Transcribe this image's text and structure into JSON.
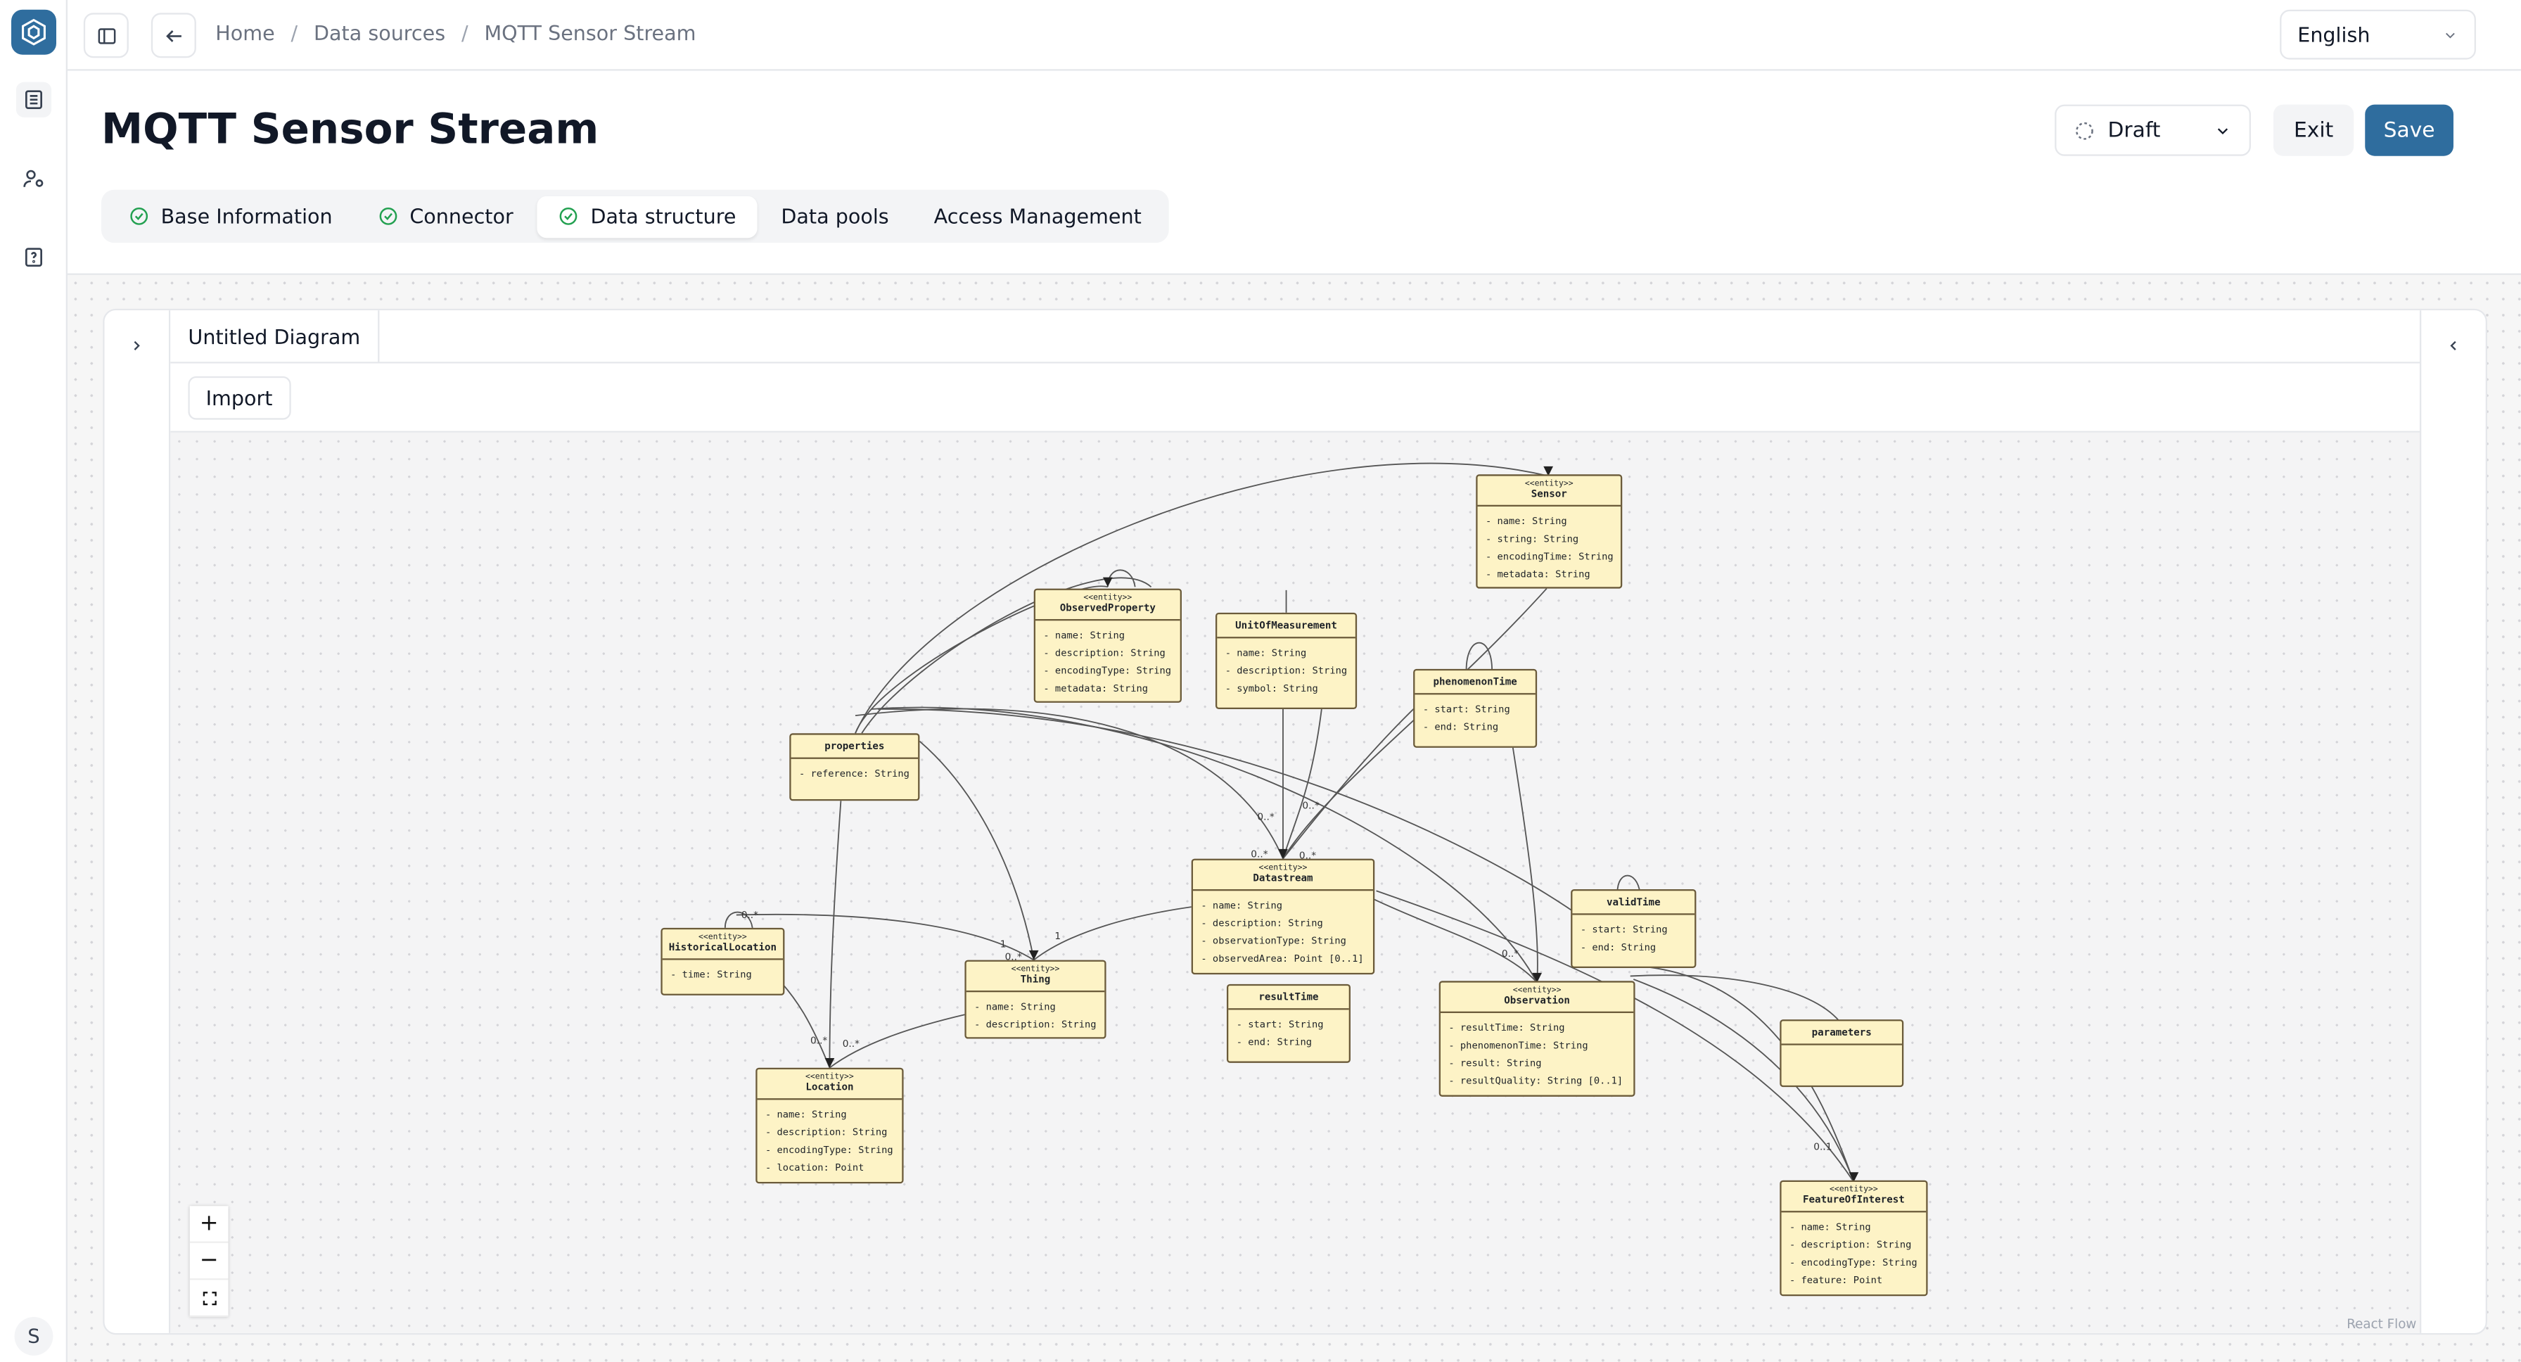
{
  "app": {
    "breadcrumbs": [
      "Home",
      "Data sources",
      "MQTT Sensor Stream"
    ],
    "language": "English",
    "avatar_initial": "S"
  },
  "page": {
    "title": "MQTT Sensor Stream",
    "status": "Draft",
    "exit_label": "Exit",
    "save_label": "Save",
    "accent_color": "#2f6d9e"
  },
  "tabs": [
    {
      "label": "Base Information",
      "done": true
    },
    {
      "label": "Connector",
      "done": true
    },
    {
      "label": "Data structure",
      "done": true,
      "active": true
    },
    {
      "label": "Data pools",
      "done": false
    },
    {
      "label": "Access Management",
      "done": false
    }
  ],
  "editor": {
    "diagram_tab": "Untitled Diagram",
    "import_label": "Import",
    "attribution": "React Flow",
    "zoom_in": "+",
    "zoom_out": "−",
    "fit": "⛶"
  },
  "diagram": {
    "stereotype": "<<entity>>",
    "nodes": {
      "sensor": {
        "name": "Sensor",
        "entity": true,
        "attrs": [
          "- name: String",
          "- string: String",
          "- encodingTime: String",
          "- metadata: String"
        ]
      },
      "observed_property": {
        "name": "ObservedProperty",
        "entity": true,
        "attrs": [
          "- name: String",
          "- description: String",
          "- encodingType: String",
          "- metadata: String"
        ]
      },
      "unit_of_measurement": {
        "name": "UnitOfMeasurement",
        "entity": false,
        "attrs": [
          "- name: String",
          "- description: String",
          "- symbol: String"
        ]
      },
      "phenomenon_time": {
        "name": "phenomenonTime",
        "entity": false,
        "attrs": [
          "- start: String",
          "- end: String"
        ]
      },
      "properties": {
        "name": "properties",
        "entity": false,
        "attrs": [
          "- reference: String"
        ]
      },
      "datastream": {
        "name": "Datastream",
        "entity": true,
        "attrs": [
          "- name: String",
          "- description: String",
          "- observationType: String",
          "- observedArea: Point [0..1]"
        ]
      },
      "valid_time": {
        "name": "validTime",
        "entity": false,
        "attrs": [
          "- start: String",
          "- end: String"
        ]
      },
      "historical_location": {
        "name": "HistoricalLocation",
        "entity": true,
        "attrs": [
          "- time: String"
        ]
      },
      "thing": {
        "name": "Thing",
        "entity": true,
        "attrs": [
          "- name: String",
          "- description: String"
        ]
      },
      "result_time": {
        "name": "resultTime",
        "entity": false,
        "attrs": [
          "- start: String",
          "- end: String"
        ]
      },
      "observation": {
        "name": "Observation",
        "entity": true,
        "attrs": [
          "- resultTime: String",
          "- phenomenonTime: String",
          "- result: String",
          "- resultQuality: String [0..1]"
        ]
      },
      "parameters": {
        "name": "parameters",
        "entity": false,
        "attrs": []
      },
      "location": {
        "name": "Location",
        "entity": true,
        "attrs": [
          "- name: String",
          "- description: String",
          "- encodingType: String",
          "- location: Point"
        ]
      },
      "feature_of_interest": {
        "name": "FeatureOfInterest",
        "entity": true,
        "attrs": [
          "- name: String",
          "- description: String",
          "- encodingType: String",
          "- feature: Point"
        ]
      }
    },
    "multiplicities": {
      "m1": "0..*",
      "m2": "0..*",
      "m3": "0..*",
      "m4": "0..*",
      "m5": "1",
      "m6": "1",
      "m7": "0..*",
      "m8": "0..*",
      "m9": "0..*",
      "m10": "0..*",
      "m11": "0..1",
      "m12": "0..*"
    }
  }
}
